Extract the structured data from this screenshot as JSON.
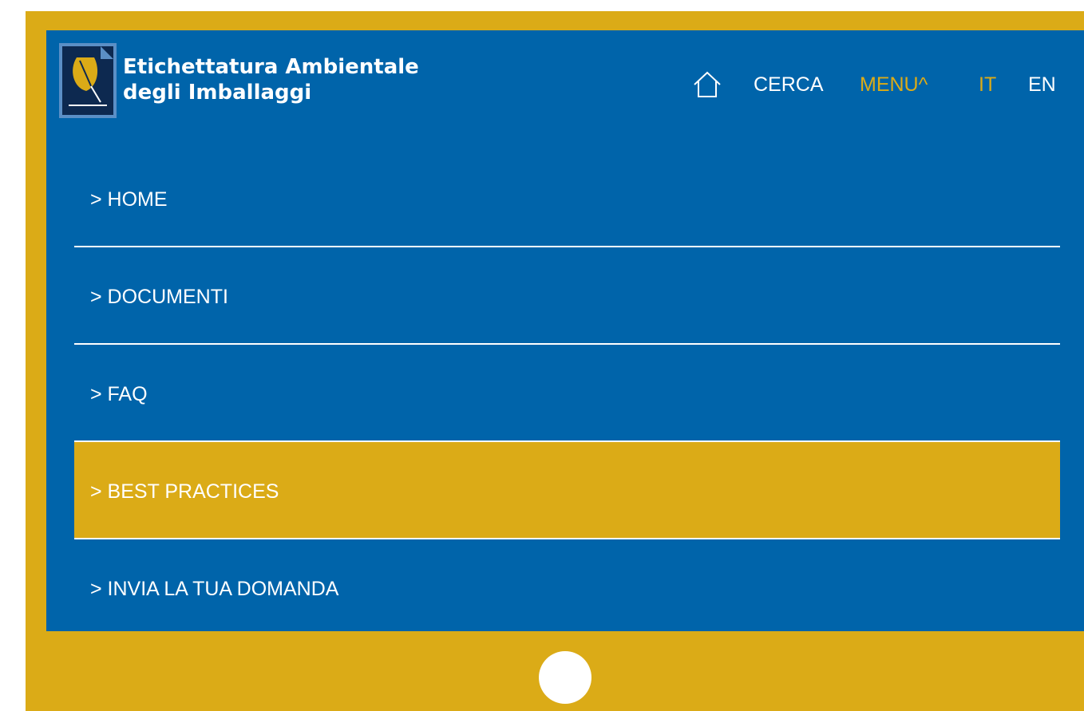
{
  "header": {
    "logo_icon": "leaf-document-icon",
    "title_line1": "Etichettatura Ambientale",
    "title_line2": "degli Imballaggi",
    "nav": {
      "home_icon": "home-icon",
      "search": "CERCA",
      "menu": "MENU^",
      "lang_it": "IT",
      "lang_en": "EN"
    }
  },
  "menu": {
    "items": [
      {
        "label": "> HOME"
      },
      {
        "label": "> DOCUMENTI"
      },
      {
        "label": "> FAQ"
      },
      {
        "label": "> BEST PRACTICES"
      },
      {
        "label": "> INVIA LA TUA DOMANDA"
      }
    ],
    "selected_label": "> BEST PRACTICES"
  },
  "colors": {
    "frame": "#dbab17",
    "screen": "#0064aa",
    "accent": "#dbab17",
    "text": "#ffffff"
  }
}
